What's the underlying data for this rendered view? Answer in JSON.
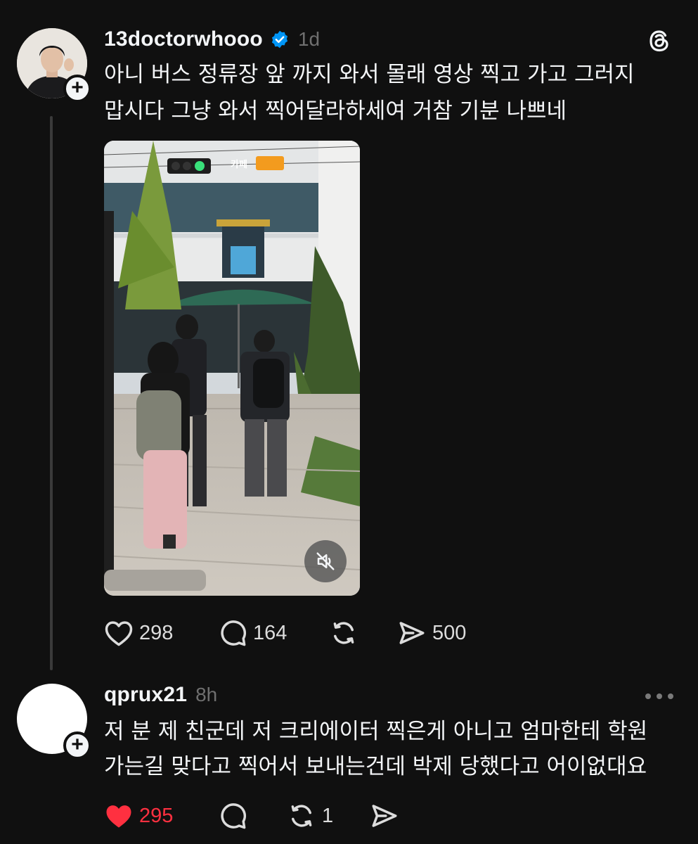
{
  "post": {
    "username": "13doctorwhooo",
    "time": "1d",
    "verified": true,
    "text_line1": "아니 버스 정류장 앞 까지 와서 몰래 영상 찍고 가고 그러지",
    "text_line2": "맙시다 그냥 와서 찍어달라하세여 거참 기분 나쁘네",
    "media_sign": "카페",
    "actions": {
      "likes": "298",
      "comments": "164",
      "shares": "500"
    }
  },
  "reply": {
    "username": "qprux21",
    "time": "8h",
    "text_line1": "저 분 제 친군데 저 크리에이터 찍은게 아니고 엄마한테 학원",
    "text_line2": "가는길 맞다고 찍어서 보내는건데 박제 당했다고 어이없대요",
    "actions": {
      "likes": "295",
      "reposts": "1"
    }
  },
  "colors": {
    "background": "#101010",
    "text": "#f3f5f7",
    "muted": "#6f6f6f",
    "verified": "#0095f6",
    "like_active": "#ff3040"
  },
  "icons": [
    "threads-logo-icon",
    "verified-badge-icon",
    "heart-icon",
    "comment-icon",
    "repost-icon",
    "share-icon",
    "mute-icon",
    "more-icon",
    "plus-icon"
  ]
}
